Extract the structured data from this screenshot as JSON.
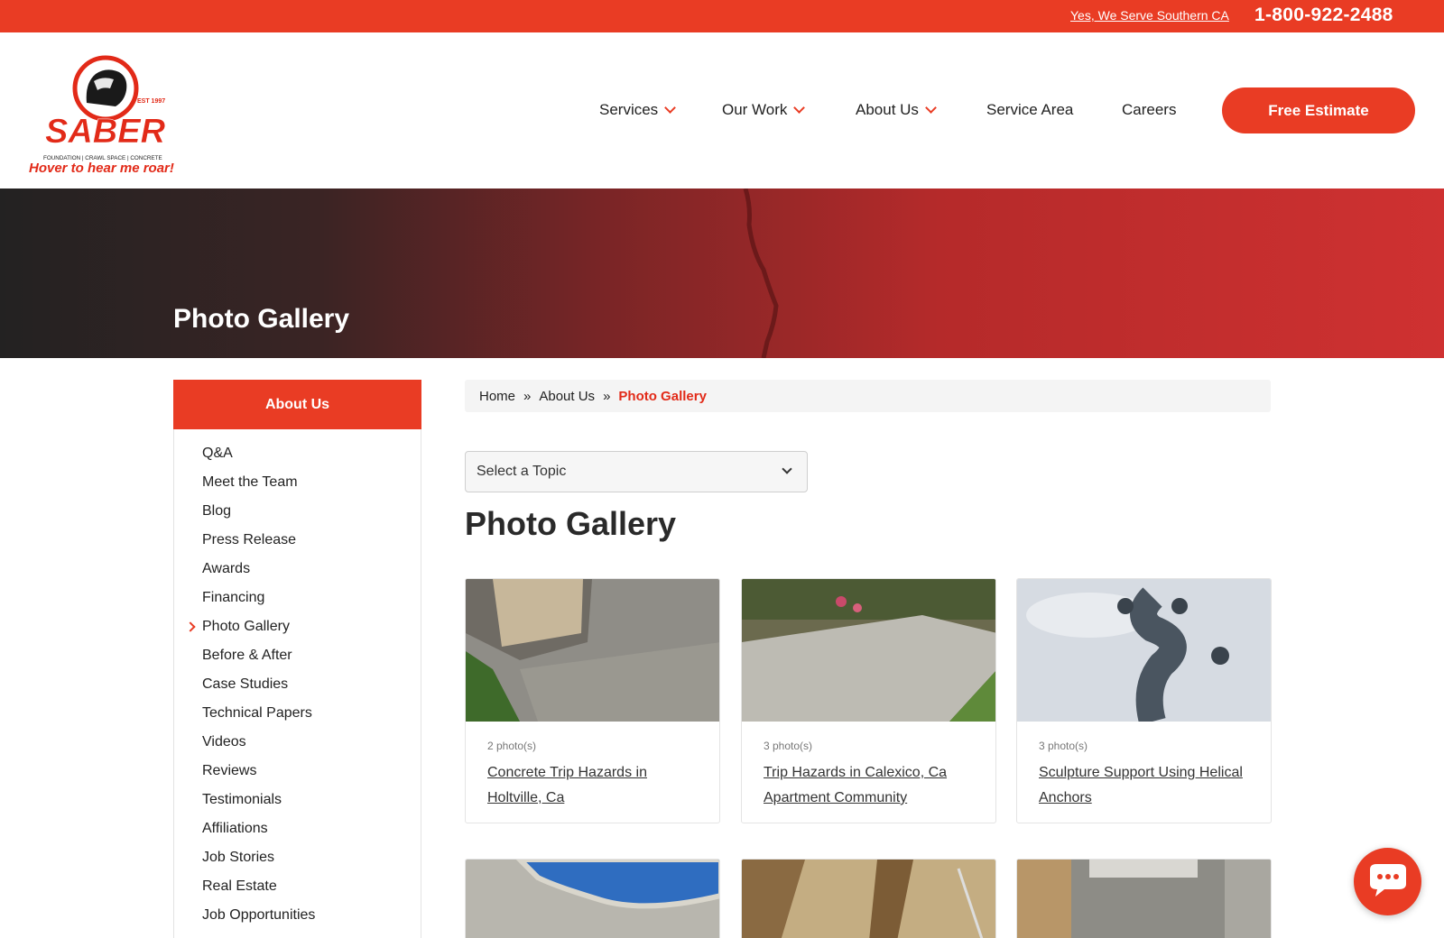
{
  "topbar": {
    "serve_link": "Yes, We Serve Southern CA",
    "phone": "1-800-922-2488"
  },
  "header": {
    "logo_text": "SABER",
    "logo_est": "EST 1997",
    "logo_sub": "FOUNDATION | CRAWL SPACE | CONCRETE",
    "hover_tag": "Hover to hear me roar!",
    "nav": {
      "services": "Services",
      "our_work": "Our Work",
      "about_us": "About Us",
      "service_area": "Service Area",
      "careers": "Careers"
    },
    "cta": "Free Estimate"
  },
  "hero": {
    "title": "Photo Gallery"
  },
  "sidebar": {
    "heading": "About Us",
    "items": [
      "Q&A",
      "Meet the Team",
      "Blog",
      "Press Release",
      "Awards",
      "Financing",
      "Photo Gallery",
      "Before & After",
      "Case Studies",
      "Technical Papers",
      "Videos",
      "Reviews",
      "Testimonials",
      "Affiliations",
      "Job Stories",
      "Real Estate",
      "Job Opportunities"
    ],
    "active": "Photo Gallery"
  },
  "breadcrumb": {
    "home": "Home",
    "sep": "»",
    "about": "About Us",
    "current": "Photo Gallery"
  },
  "topic_select": {
    "value": "Select a Topic"
  },
  "main": {
    "title": "Photo Gallery"
  },
  "gallery": [
    {
      "count": "2 photo(s)",
      "title": "Concrete Trip Hazards in Holtville, Ca"
    },
    {
      "count": "3 photo(s)",
      "title": "Trip Hazards in Calexico, Ca Apartment Community"
    },
    {
      "count": "3 photo(s)",
      "title": "Sculpture Support Using Helical Anchors"
    }
  ],
  "icons": {
    "nav_chevron": "chevron-down-icon",
    "chat": "chat-bubble-icon",
    "select_chevron": "chevron-down-icon"
  },
  "colors": {
    "accent": "#e93c24",
    "accent_text": "#e22a18"
  }
}
